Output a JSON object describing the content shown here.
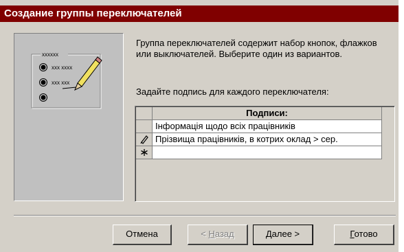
{
  "window": {
    "title": "Создание группы переключателей"
  },
  "description": "Группа переключателей содержит набор кнопок, флажков или выключателей. Выберите один из вариантов.",
  "prompt": "Задайте подпись для каждого переключателя:",
  "grid": {
    "header": "Подписи:",
    "rows": [
      {
        "selector": "",
        "value": "Інформація щодо всіх працівників"
      },
      {
        "selector": "pencil-icon",
        "value": "Прізвища працівників, в котрих оклад > сер."
      },
      {
        "selector": "asterisk-icon",
        "value": ""
      }
    ]
  },
  "buttons": {
    "cancel": "Отмена",
    "back_key": "Н",
    "back_rest": "азад",
    "back_prefix": "< ",
    "next_key": "Д",
    "next_rest": "алее >",
    "finish_key": "Г",
    "finish_rest": "отово"
  },
  "illustration": {
    "label_glyphs": "xxxxxx",
    "option_1": "xxx xxxx",
    "option_2": "xxx xxx"
  }
}
